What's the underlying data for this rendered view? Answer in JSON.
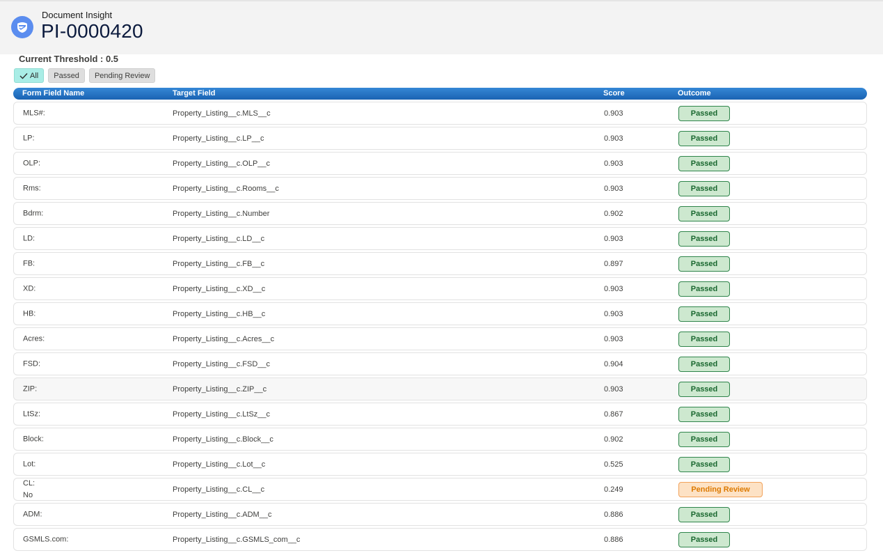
{
  "header": {
    "eyebrow": "Document Insight",
    "title": "PI-0000420",
    "icon": "document-insight-icon",
    "icon_color": "#5b8def"
  },
  "threshold_label": "Current Threshold : 0.5",
  "filters": [
    {
      "label": "All",
      "active": true
    },
    {
      "label": "Passed",
      "active": false
    },
    {
      "label": "Pending Review",
      "active": false
    }
  ],
  "columns": {
    "form_field_name": "Form Field Name",
    "target_field": "Target Field",
    "score": "Score",
    "outcome": "Outcome"
  },
  "colors": {
    "header_blue": "#1a63b2",
    "passed_green": "#2e844a",
    "pending_orange": "#dd7a01",
    "active_filter": "#a9ede6"
  },
  "rows": [
    {
      "name": "MLS#:",
      "target": "Property_Listing__c.MLS__c",
      "score": "0.903",
      "outcome": "Passed"
    },
    {
      "name": "LP:",
      "target": "Property_Listing__c.LP__c",
      "score": "0.903",
      "outcome": "Passed"
    },
    {
      "name": "OLP:",
      "target": "Property_Listing__c.OLP__c",
      "score": "0.903",
      "outcome": "Passed"
    },
    {
      "name": "Rms:",
      "target": "Property_Listing__c.Rooms__c",
      "score": "0.903",
      "outcome": "Passed"
    },
    {
      "name": "Bdrm:",
      "target": "Property_Listing__c.Number",
      "score": "0.902",
      "outcome": "Passed"
    },
    {
      "name": "LD:",
      "target": "Property_Listing__c.LD__c",
      "score": "0.903",
      "outcome": "Passed"
    },
    {
      "name": "FB:",
      "target": "Property_Listing__c.FB__c",
      "score": "0.897",
      "outcome": "Passed"
    },
    {
      "name": "XD:",
      "target": "Property_Listing__c.XD__c",
      "score": "0.903",
      "outcome": "Passed"
    },
    {
      "name": "HB:",
      "target": "Property_Listing__c.HB__c",
      "score": "0.903",
      "outcome": "Passed"
    },
    {
      "name": "Acres:",
      "target": "Property_Listing__c.Acres__c",
      "score": "0.903",
      "outcome": "Passed"
    },
    {
      "name": "FSD:",
      "target": "Property_Listing__c.FSD__c",
      "score": "0.904",
      "outcome": "Passed"
    },
    {
      "name": "ZIP:",
      "target": "Property_Listing__c.ZIP__c",
      "score": "0.903",
      "outcome": "Passed",
      "highlighted": true
    },
    {
      "name": "LtSz:",
      "target": "Property_Listing__c.LtSz__c",
      "score": "0.867",
      "outcome": "Passed"
    },
    {
      "name": "Block:",
      "target": "Property_Listing__c.Block__c",
      "score": "0.902",
      "outcome": "Passed"
    },
    {
      "name": "Lot:",
      "target": "Property_Listing__c.Lot__c",
      "score": "0.525",
      "outcome": "Passed"
    },
    {
      "name": "CL:",
      "name_value": "No",
      "target": "Property_Listing__c.CL__c",
      "score": "0.249",
      "outcome": "Pending Review"
    },
    {
      "name": "ADM:",
      "target": "Property_Listing__c.ADM__c",
      "score": "0.886",
      "outcome": "Passed"
    },
    {
      "name": "GSMLS.com:",
      "target": "Property_Listing__c.GSMLS_com__c",
      "score": "0.886",
      "outcome": "Passed"
    }
  ]
}
